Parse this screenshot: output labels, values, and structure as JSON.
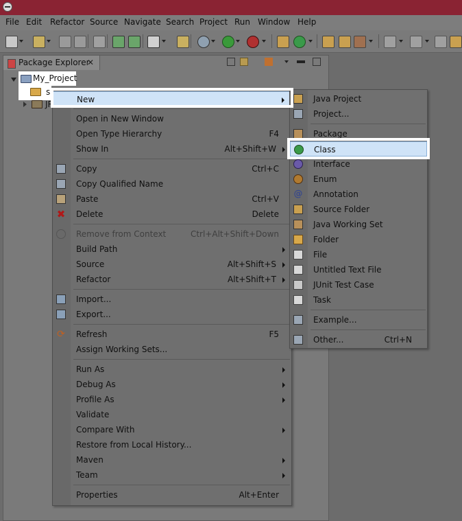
{
  "menubar": {
    "items": [
      "File",
      "Edit",
      "Refactor",
      "Source",
      "Navigate",
      "Search",
      "Project",
      "Run",
      "Window",
      "Help"
    ]
  },
  "explorer": {
    "tab_label": "Package Explorer",
    "close_glyph": "✕",
    "project_name": "My_Project",
    "src_label": "sr",
    "jre_label": "JR"
  },
  "context_menu": {
    "items": [
      {
        "label": "New",
        "shortcut": "",
        "submenu": true,
        "icon": "none"
      },
      {
        "label": "Open in New Window",
        "shortcut": "",
        "submenu": false,
        "icon": "none"
      },
      {
        "label": "Open Type Hierarchy",
        "shortcut": "F4",
        "submenu": false,
        "icon": "none"
      },
      {
        "label": "Show In",
        "shortcut": "Alt+Shift+W",
        "submenu": true,
        "icon": "none"
      },
      {
        "label": "Copy",
        "shortcut": "Ctrl+C",
        "submenu": false,
        "icon": "copy-icon"
      },
      {
        "label": "Copy Qualified Name",
        "shortcut": "",
        "submenu": false,
        "icon": "copy-qualified-icon"
      },
      {
        "label": "Paste",
        "shortcut": "Ctrl+V",
        "submenu": false,
        "icon": "paste-icon"
      },
      {
        "label": "Delete",
        "shortcut": "Delete",
        "submenu": false,
        "icon": "delete-icon"
      },
      {
        "label": "Remove from Context",
        "shortcut": "Ctrl+Alt+Shift+Down",
        "submenu": false,
        "icon": "remove-context-icon",
        "disabled": true
      },
      {
        "label": "Build Path",
        "shortcut": "",
        "submenu": true,
        "icon": "none"
      },
      {
        "label": "Source",
        "shortcut": "Alt+Shift+S",
        "submenu": true,
        "icon": "none"
      },
      {
        "label": "Refactor",
        "shortcut": "Alt+Shift+T",
        "submenu": true,
        "icon": "none"
      },
      {
        "label": "Import...",
        "shortcut": "",
        "submenu": false,
        "icon": "import-icon"
      },
      {
        "label": "Export...",
        "shortcut": "",
        "submenu": false,
        "icon": "export-icon"
      },
      {
        "label": "Refresh",
        "shortcut": "F5",
        "submenu": false,
        "icon": "refresh-icon"
      },
      {
        "label": "Assign Working Sets...",
        "shortcut": "",
        "submenu": false,
        "icon": "none"
      },
      {
        "label": "Run As",
        "shortcut": "",
        "submenu": true,
        "icon": "none"
      },
      {
        "label": "Debug As",
        "shortcut": "",
        "submenu": true,
        "icon": "none"
      },
      {
        "label": "Profile As",
        "shortcut": "",
        "submenu": true,
        "icon": "none"
      },
      {
        "label": "Validate",
        "shortcut": "",
        "submenu": false,
        "icon": "none"
      },
      {
        "label": "Compare With",
        "shortcut": "",
        "submenu": true,
        "icon": "none"
      },
      {
        "label": "Restore from Local History...",
        "shortcut": "",
        "submenu": false,
        "icon": "none"
      },
      {
        "label": "Maven",
        "shortcut": "",
        "submenu": true,
        "icon": "none"
      },
      {
        "label": "Team",
        "shortcut": "",
        "submenu": true,
        "icon": "none"
      },
      {
        "label": "Properties",
        "shortcut": "Alt+Enter",
        "submenu": false,
        "icon": "none"
      }
    ]
  },
  "new_submenu": {
    "items": [
      {
        "label": "Java Project",
        "shortcut": "",
        "icon": "java-project-icon"
      },
      {
        "label": "Project...",
        "shortcut": "",
        "icon": "project-icon"
      },
      {
        "label": "Package",
        "shortcut": "",
        "icon": "package-icon"
      },
      {
        "label": "Class",
        "shortcut": "",
        "icon": "class-icon"
      },
      {
        "label": "Interface",
        "shortcut": "",
        "icon": "interface-icon"
      },
      {
        "label": "Enum",
        "shortcut": "",
        "icon": "enum-icon"
      },
      {
        "label": "Annotation",
        "shortcut": "",
        "icon": "annotation-icon"
      },
      {
        "label": "Source Folder",
        "shortcut": "",
        "icon": "source-folder-icon"
      },
      {
        "label": "Java Working Set",
        "shortcut": "",
        "icon": "working-set-icon"
      },
      {
        "label": "Folder",
        "shortcut": "",
        "icon": "folder-icon"
      },
      {
        "label": "File",
        "shortcut": "",
        "icon": "file-icon"
      },
      {
        "label": "Untitled Text File",
        "shortcut": "",
        "icon": "text-file-icon"
      },
      {
        "label": "JUnit Test Case",
        "shortcut": "",
        "icon": "junit-icon"
      },
      {
        "label": "Task",
        "shortcut": "",
        "icon": "task-icon"
      },
      {
        "label": "Example...",
        "shortcut": "",
        "icon": "example-icon"
      },
      {
        "label": "Other...",
        "shortcut": "Ctrl+N",
        "icon": "other-icon"
      }
    ]
  },
  "colors": {
    "highlight": "#cfe3f7",
    "highlight_border": "#8ab0d8",
    "title_bar": "#8a2333",
    "frame": "#ffffff"
  }
}
